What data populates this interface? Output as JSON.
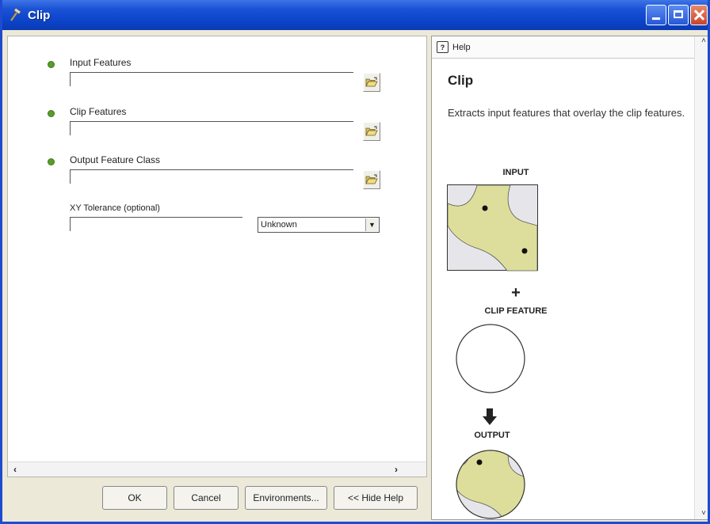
{
  "window": {
    "title": "Clip",
    "title_icon": "hammer-icon",
    "controls": [
      "minimize-icon",
      "maximize-icon",
      "close-icon"
    ]
  },
  "parameters": {
    "input_features": {
      "label": "Input Features",
      "value": ""
    },
    "clip_features": {
      "label": "Clip Features",
      "value": ""
    },
    "output_feature_class": {
      "label": "Output Feature Class",
      "value": ""
    },
    "xy_tolerance": {
      "label": "XY Tolerance (optional)",
      "value": "",
      "unit": "Unknown"
    }
  },
  "buttons": {
    "ok": "OK",
    "cancel": "Cancel",
    "environments": "Environments...",
    "hide_help": "<< Hide Help"
  },
  "help": {
    "header": "Help",
    "title": "Clip",
    "description": "Extracts input features that overlay the clip features.",
    "diagram": {
      "input_label": "INPUT",
      "plus_symbol": "+",
      "clip_label": "CLIP FEATURE",
      "output_label": "OUTPUT"
    }
  },
  "colors": {
    "titlebar": "#0b43c9",
    "required_dot": "#5a9c2a",
    "diagram_fill": "#dede9c"
  }
}
